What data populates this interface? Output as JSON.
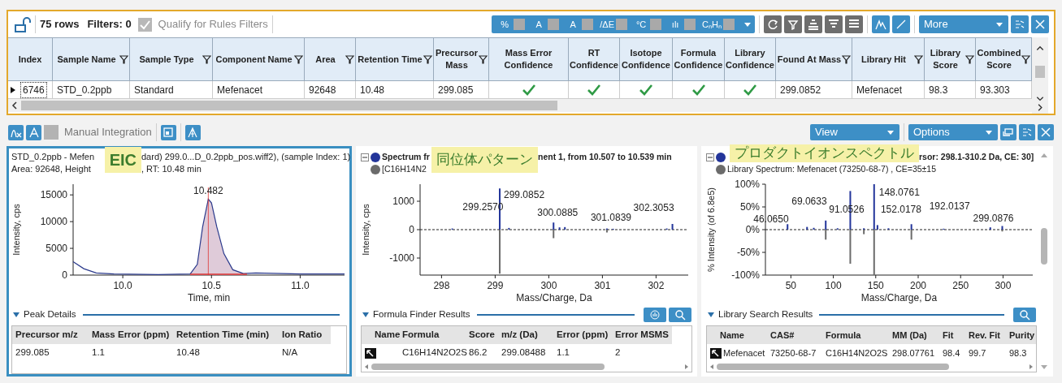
{
  "results_table": {
    "toolbar": {
      "rows_count": "75 rows",
      "filters": "Filters: 0",
      "qualify": {
        "label": "Qualify for Rules Filters",
        "checked": true,
        "disabled": true
      },
      "flag_toggles": [
        {
          "label": "%",
          "checked": false
        },
        {
          "label": "A",
          "checked": false
        },
        {
          "label": "A",
          "checked": false
        },
        {
          "label": "/ΔE",
          "checked": false
        },
        {
          "label": "°C",
          "checked": false
        },
        {
          "label": "ılı",
          "checked": false
        },
        {
          "label": "CₙHₙ",
          "checked": false
        }
      ],
      "more": "More"
    },
    "columns": [
      {
        "label": "Index",
        "kind": "text",
        "filterable": false
      },
      {
        "label": "Sample Name",
        "kind": "text",
        "filterable": true
      },
      {
        "label": "Sample Type",
        "kind": "text",
        "filterable": true
      },
      {
        "label": "Component Name",
        "kind": "text",
        "filterable": true
      },
      {
        "label": "Area",
        "kind": "text",
        "filterable": true
      },
      {
        "label": "Retention Time",
        "kind": "text",
        "filterable": true
      },
      {
        "label": "Precursor Mass",
        "kind": "text",
        "filterable": true
      },
      {
        "label": "Mass Error Confidence",
        "kind": "check",
        "filterable": false
      },
      {
        "label": "RT Confidence",
        "kind": "check",
        "filterable": false
      },
      {
        "label": "Isotope Confidence",
        "kind": "check",
        "filterable": false
      },
      {
        "label": "Formula Confidence",
        "kind": "check",
        "filterable": false
      },
      {
        "label": "Library Confidence",
        "kind": "check",
        "filterable": false
      },
      {
        "label": "Found At Mass",
        "kind": "text",
        "filterable": true
      },
      {
        "label": "Library Hit",
        "kind": "text",
        "filterable": true
      },
      {
        "label": "Library Score",
        "kind": "text",
        "filterable": true
      },
      {
        "label": "Combined Score",
        "kind": "text",
        "filterable": true
      }
    ],
    "rows": [
      {
        "current": true,
        "cells": [
          "6746",
          "STD_0.2ppb",
          "Standard",
          "Mefenacet",
          "92648",
          "10.48",
          "299.085",
          true,
          true,
          true,
          true,
          true,
          "299.0852",
          "Mefenacet",
          "98.3",
          "93.303"
        ]
      }
    ]
  },
  "panel_toolbar": {
    "manual_integration": {
      "label": "Manual Integration",
      "checked": false
    },
    "view": "View",
    "options": "Options"
  },
  "panels": [
    {
      "kind": "eic",
      "selected": true,
      "callout": "EIC",
      "header_lines": [
        {
          "parts": [
            {
              "text": "STD_0.2ppb - Mefen",
              "after_callout": false
            },
            {
              "text": "dard) 299.0...D_0.2ppb_pos.wiff2), (sample Index: 1)",
              "after_callout": true
            }
          ]
        },
        {
          "parts": [
            {
              "text": "Area: 92648, Height",
              "after_callout": false
            },
            {
              "text": ", RT: 10.48 min",
              "after_callout": true
            }
          ]
        }
      ],
      "chart_data": {
        "type": "line",
        "xlabel": "Time, min",
        "ylabel": "Intensity, cps",
        "xlim": [
          9.72,
          11.25
        ],
        "ylim": [
          0,
          17000
        ],
        "xticks": [
          {
            "value": 10,
            "label": "10.0"
          },
          {
            "value": 10.5,
            "label": "10.5"
          },
          {
            "value": 11,
            "label": "11.0"
          }
        ],
        "yticks": [
          0,
          5000,
          10000,
          15000
        ],
        "x": [
          9.72,
          9.78,
          9.85,
          9.95,
          10.2,
          10.38,
          10.42,
          10.45,
          10.482,
          10.5,
          10.53,
          10.57,
          10.62,
          10.68,
          10.75,
          11.0,
          11.25
        ],
        "series": [
          {
            "color": "#2b3a8c",
            "values": [
              2500,
              1200,
              400,
              200,
              100,
              200,
              2000,
              9000,
              14200,
              13500,
              9000,
              4000,
              1000,
              300,
              400,
              200,
              200
            ]
          }
        ],
        "ref_lines": [
          {
            "axis": "x",
            "value": 10.482,
            "color": "#dd3333"
          }
        ],
        "annotations": [
          {
            "x": 10.482,
            "y": 14200,
            "text": "10.482"
          }
        ]
      },
      "section": {
        "title": "Peak Details"
      },
      "table": {
        "columns": [
          "Precursor m/z",
          "Mass Error (ppm)",
          "Retention Time (min)",
          "Ion Ratio"
        ],
        "rows": [
          [
            "299.085",
            "1.1",
            "10.48",
            "N/A"
          ]
        ],
        "hscroll": false
      }
    },
    {
      "kind": "spectrum",
      "selected": false,
      "callout": "同位体パターン",
      "header_lines": [
        {
          "collapse": true,
          "color": "#23359a",
          "parts": [
            {
              "text": "Spectrum fr",
              "after_callout": false
            },
            {
              "text": "nent 1, from 10.507 to 10.539 min",
              "after_callout": true
            }
          ]
        },
        {
          "collapse": false,
          "color": "#6b6b6b",
          "parts": [
            {
              "text": "[C16H14N2",
              "after_callout": false
            }
          ]
        }
      ],
      "chart_data": {
        "type": "bar",
        "xlabel": "Mass/Charge, Da",
        "ylabel": "Intensity, cps",
        "xlim": [
          297.6,
          302.6
        ],
        "ylim": [
          -1600,
          1600
        ],
        "xticks": [
          298,
          299,
          300,
          301,
          302
        ],
        "yticks": [
          -1000,
          0,
          1000
        ],
        "x": [
          298.2,
          299.0852,
          299.257,
          300.0885,
          300.2,
          300.3,
          301.0839,
          301.2,
          302.2,
          302.3053
        ],
        "series": [
          {
            "color": "#23359a",
            "values": [
              40,
              1450,
              60,
              250,
              80,
              90,
              40,
              30,
              40,
              200
            ]
          },
          {
            "color": "#6b6b6b",
            "values": [
              null,
              -1550,
              null,
              -300,
              null,
              null,
              -100,
              null,
              null,
              null
            ]
          }
        ],
        "annotations": [
          {
            "x": 299.257,
            "y": 60,
            "text": "299.2570"
          },
          {
            "x": 299.0852,
            "y": 1450,
            "text": "299.0852"
          },
          {
            "x": 300.0885,
            "y": 250,
            "text": "300.0885"
          },
          {
            "x": 301.0839,
            "y": 40,
            "text": "301.0839"
          },
          {
            "x": 302.3053,
            "y": 200,
            "text": "302.3053"
          }
        ]
      },
      "section": {
        "title": "Formula Finder Results"
      },
      "table": {
        "columns": [
          "Name",
          "Formula",
          "Score",
          "m/z (Da)",
          "Error (ppm)",
          "Error MSMS"
        ],
        "rows": [
          [
            "",
            "C16H14N2O2S",
            "86.2",
            "299.08488",
            "1.1",
            "2"
          ]
        ],
        "hscroll": true
      }
    },
    {
      "kind": "spectrum",
      "selected": false,
      "callout": "プロダクトイオンスペクトル",
      "header_lines": [
        {
          "collapse": true,
          "color": "#23359a",
          "parts": [
            {
              "text": "rsor: 298.1-310.2 Da, CE: 30]",
              "after_callout": true
            }
          ]
        },
        {
          "collapse": false,
          "color": "#6b6b6b",
          "parts": [
            {
              "text": "Library Spectrum: Mefenacet (73250-68-7) , CE=35±15",
              "after_callout": false
            }
          ]
        }
      ],
      "chart_data": {
        "type": "bar",
        "xlabel": "Mass/Charge, Da",
        "ylabel": "% Intensity (of 6.8e5)",
        "xlim": [
          20,
          335
        ],
        "ylim": [
          -100,
          100
        ],
        "xticks": [
          50,
          100,
          150,
          200,
          250,
          300
        ],
        "yticks": [
          {
            "value": -100,
            "label": "-100%"
          },
          {
            "value": -50,
            "label": "-50%"
          },
          {
            "value": 0,
            "label": "0%"
          },
          {
            "value": 50,
            "label": "50%"
          },
          {
            "value": 100,
            "label": "100%"
          }
        ],
        "x": [
          46.065,
          69.0633,
          77,
          91.0526,
          105,
          120,
          136,
          148.0761,
          152.0178,
          165,
          192.0137,
          230,
          285,
          299.0876
        ],
        "series": [
          {
            "color": "#23359a",
            "values": [
              12,
              6,
              4,
              20,
              3,
              85,
              3,
              100,
              10,
              3,
              12,
              2,
              5,
              8
            ]
          },
          {
            "color": "#6b6b6b",
            "values": [
              null,
              null,
              null,
              -22,
              null,
              -75,
              -10,
              -100,
              null,
              null,
              -22,
              null,
              null,
              -4
            ]
          }
        ],
        "annotations": [
          {
            "x": 46.065,
            "y": 12,
            "text": "46.0650"
          },
          {
            "x": 69.0633,
            "y": 6,
            "text": "69.0633"
          },
          {
            "x": 91.0526,
            "y": 20,
            "text": "91.0526"
          },
          {
            "x": 148.0761,
            "y": 100,
            "text": "148.0761"
          },
          {
            "x": 152.0178,
            "y": 10,
            "text": "152.0178"
          },
          {
            "x": 192.0137,
            "y": 12,
            "text": "192.0137"
          },
          {
            "x": 299.0876,
            "y": 8,
            "text": "299.0876"
          }
        ]
      },
      "section": {
        "title": "Library Search Results"
      },
      "table": {
        "columns": [
          "Name",
          "CAS#",
          "Formula",
          "MM (Da)",
          "Fit",
          "Rev. Fit",
          "Purity"
        ],
        "rows": [
          [
            "Mefenacet",
            "73250-68-7",
            "C16H14N2O2S",
            "298.07761",
            "98.4",
            "99.7",
            "98.3"
          ]
        ],
        "hscroll": true
      }
    }
  ]
}
